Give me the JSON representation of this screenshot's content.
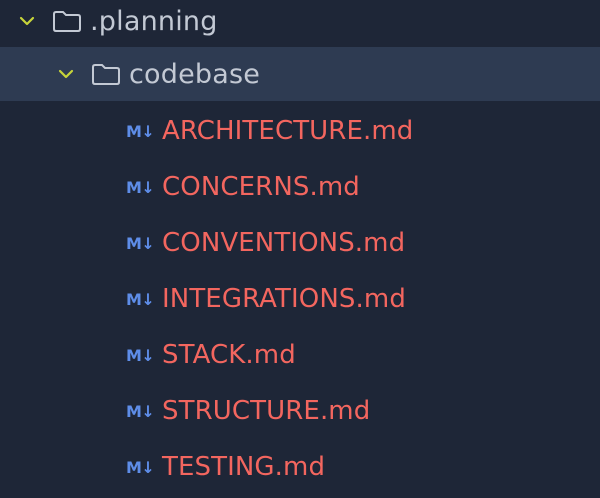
{
  "tree": {
    "root_folder": {
      "label": ".planning",
      "expanded": true,
      "icon": "folder-icon",
      "chevron_color": "#c7d43a"
    },
    "sub_folder": {
      "label": "codebase",
      "expanded": true,
      "selected": true,
      "icon": "folder-icon",
      "chevron_color": "#c7d43a"
    },
    "files": [
      {
        "label": "ARCHITECTURE.md",
        "icon": "markdown-icon"
      },
      {
        "label": "CONCERNS.md",
        "icon": "markdown-icon"
      },
      {
        "label": "CONVENTIONS.md",
        "icon": "markdown-icon"
      },
      {
        "label": "INTEGRATIONS.md",
        "icon": "markdown-icon"
      },
      {
        "label": "STACK.md",
        "icon": "markdown-icon"
      },
      {
        "label": "STRUCTURE.md",
        "icon": "markdown-icon"
      },
      {
        "label": "TESTING.md",
        "icon": "markdown-icon"
      }
    ],
    "markdown_icon_text": "M↓",
    "colors": {
      "background": "#1e2637",
      "selected_row": "#2e3b52",
      "folder_text": "#c3c9d4",
      "file_text": "#f3665f",
      "markdown_icon": "#5e8de8"
    }
  }
}
